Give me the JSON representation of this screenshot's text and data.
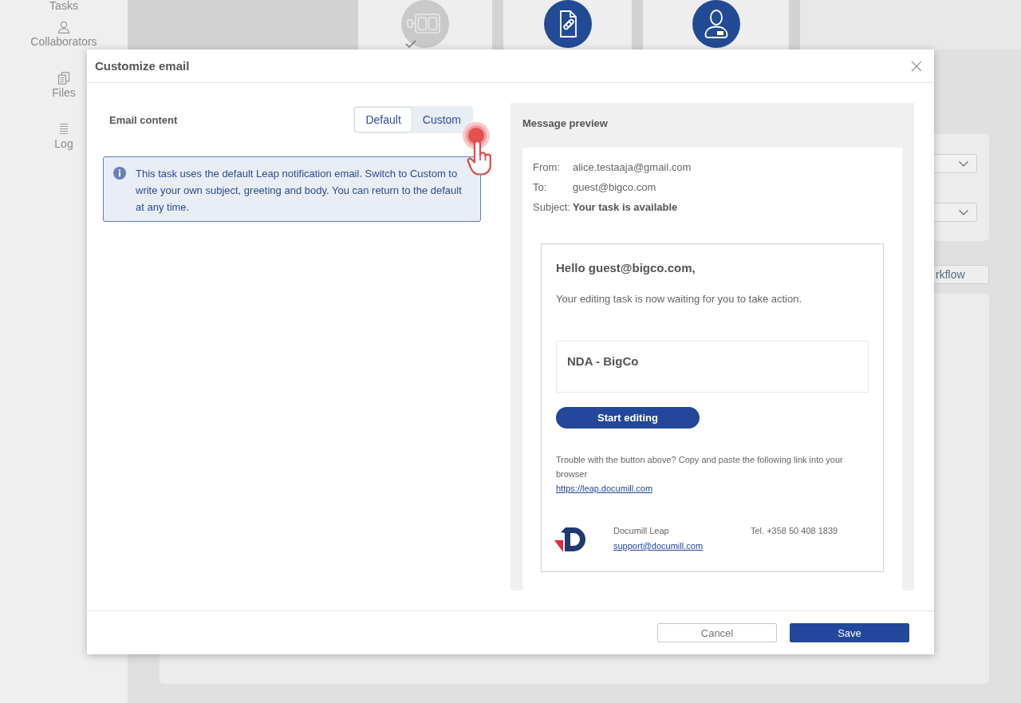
{
  "sidebar": {
    "items": [
      {
        "label": "Tasks",
        "kind": "tasks"
      },
      {
        "label": "Collaborators",
        "kind": "person"
      },
      {
        "label": "Files",
        "kind": "files"
      },
      {
        "label": "Log",
        "kind": "log"
      }
    ]
  },
  "steps": [
    {
      "kind": "workflow",
      "completed": true
    },
    {
      "kind": "document",
      "completed": false
    },
    {
      "kind": "person",
      "completed": false
    }
  ],
  "background": {
    "button": "rkflow"
  },
  "dialog": {
    "title": "Customize email",
    "email_content": {
      "label": "Email content",
      "options": [
        {
          "label": "Default",
          "selected": true
        },
        {
          "label": "Custom",
          "selected": false
        }
      ]
    },
    "info": "This task uses the default Leap notification email. Switch to Custom to write your own subject, greeting and body. You can return to the default at any time.",
    "preview": {
      "title": "Message preview",
      "headers": [
        {
          "label": "From:",
          "value": "alice.testaaja@gmail.com",
          "kind": "address"
        },
        {
          "label": "To:",
          "value": "guest@bigco.com",
          "kind": "address"
        },
        {
          "label": "Subject:",
          "value": "Your task is available",
          "kind": "subject"
        }
      ],
      "email": {
        "greeting": "Hello guest@bigco.com,",
        "body": "Your editing task is now waiting for you to take action.",
        "document": "NDA - BigCo",
        "button": "Start editing",
        "help": "Trouble with the button above? Copy and paste the following link into your browser",
        "link": "https://leap.documill.com",
        "company": "Documill Leap",
        "support": "support@documill.com",
        "phone": "Tel. +358 50 408 1839"
      }
    },
    "buttons": [
      {
        "label": "Cancel",
        "kind": "secondary"
      },
      {
        "label": "Save",
        "kind": "primary"
      }
    ]
  }
}
